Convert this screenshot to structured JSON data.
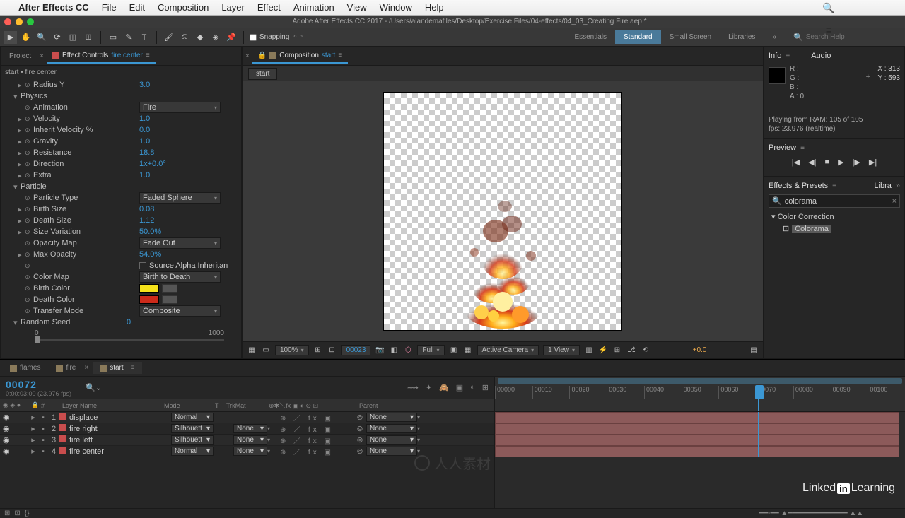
{
  "menu": {
    "apple": "",
    "appName": "After Effects CC",
    "items": [
      "File",
      "Edit",
      "Composition",
      "Layer",
      "Effect",
      "Animation",
      "View",
      "Window",
      "Help"
    ]
  },
  "titlebar": {
    "title": "Adobe After Effects CC 2017 - /Users/alandemafiles/Desktop/Exercise Files/04-effects/04_03_Creating Fire.aep *"
  },
  "toolbar": {
    "snappingLabel": "Snapping",
    "workspaces": [
      "Essentials",
      "Standard",
      "Small Screen",
      "Libraries"
    ],
    "activeWorkspace": "Standard",
    "searchPlaceholder": "Search Help"
  },
  "leftPanel": {
    "tabs": [
      {
        "label": "Project"
      },
      {
        "label": "Effect Controls",
        "comp": "fire center",
        "active": true
      }
    ],
    "header": "start • fire center",
    "rows": [
      {
        "type": "prop",
        "name": "Radius Y",
        "val": "3.0",
        "indent": "group"
      },
      {
        "type": "group",
        "name": "Physics"
      },
      {
        "type": "select",
        "name": "Animation",
        "val": "Fire"
      },
      {
        "type": "prop",
        "name": "Velocity",
        "val": "1.0"
      },
      {
        "type": "prop",
        "name": "Inherit Velocity %",
        "val": "0.0"
      },
      {
        "type": "prop",
        "name": "Gravity",
        "val": "1.0"
      },
      {
        "type": "prop",
        "name": "Resistance",
        "val": "18.8"
      },
      {
        "type": "prop",
        "name": "Direction",
        "val": "1x+0.0°"
      },
      {
        "type": "prop",
        "name": "Extra",
        "val": "1.0"
      },
      {
        "type": "group",
        "name": "Particle"
      },
      {
        "type": "select",
        "name": "Particle Type",
        "val": "Faded Sphere"
      },
      {
        "type": "prop",
        "name": "Birth Size",
        "val": "0.08"
      },
      {
        "type": "prop",
        "name": "Death Size",
        "val": "1.12"
      },
      {
        "type": "prop",
        "name": "Size Variation",
        "val": "50.0%"
      },
      {
        "type": "select",
        "name": "Opacity Map",
        "val": "Fade Out"
      },
      {
        "type": "prop",
        "name": "Max Opacity",
        "val": "54.0%"
      },
      {
        "type": "checkbox",
        "name": "",
        "val": "Source Alpha Inheritan"
      },
      {
        "type": "select",
        "name": "Color Map",
        "val": "Birth to Death"
      },
      {
        "type": "color",
        "name": "Birth Color",
        "color": "#f5e21a"
      },
      {
        "type": "color",
        "name": "Death Color",
        "color": "#cc2a1a"
      },
      {
        "type": "select",
        "name": "Transfer Mode",
        "val": "Composite"
      },
      {
        "type": "group",
        "name": "Random Seed",
        "val": "0"
      },
      {
        "type": "slider",
        "min": "0",
        "max": "1000"
      }
    ]
  },
  "centerPanel": {
    "tab": "Composition",
    "comp": "start",
    "subTab": "start",
    "viewer": {
      "zoom": "100%",
      "timecode": "00023",
      "res": "Full",
      "camera": "Active Camera",
      "views": "1 View",
      "exposure": "+0.0"
    }
  },
  "rightPanel": {
    "info": {
      "title": "Info",
      "audio": "Audio",
      "R": "R :",
      "G": "G :",
      "B": "B :",
      "A": "A : 0",
      "X": "X : 313",
      "Y": "Y : 593",
      "msg1": "Playing from RAM: 105 of 105",
      "msg2": "fps: 23.976 (realtime)"
    },
    "preview": {
      "title": "Preview"
    },
    "ep": {
      "title": "Effects & Presets",
      "libra": "Libra",
      "search": "colorama",
      "group": "Color Correction",
      "item": "Colorama"
    }
  },
  "timeline": {
    "tabs": [
      {
        "label": "flames"
      },
      {
        "label": "fire"
      },
      {
        "label": "start",
        "active": true
      }
    ],
    "timecode": "00072",
    "fps": "0:00:03:00 (23.976 fps)",
    "cols": {
      "layerName": "Layer Name",
      "mode": "Mode",
      "t": "T",
      "trkMat": "TrkMat",
      "parent": "Parent"
    },
    "layers": [
      {
        "num": "1",
        "name": "displace",
        "mode": "Normal",
        "trk": "",
        "parent": "None"
      },
      {
        "num": "2",
        "name": "fire right",
        "mode": "Silhouett",
        "trk": "None",
        "parent": "None"
      },
      {
        "num": "3",
        "name": "fire left",
        "mode": "Silhouett",
        "trk": "None",
        "parent": "None"
      },
      {
        "num": "4",
        "name": "fire center",
        "mode": "Normal",
        "trk": "None",
        "parent": "None"
      }
    ],
    "ruler": [
      "00000",
      "00010",
      "00020",
      "00030",
      "00040",
      "00050",
      "00060",
      "00070",
      "00080",
      "00090",
      "00100"
    ]
  },
  "brand": {
    "text1": "Linked",
    "in": "in",
    "text2": "Learning"
  }
}
